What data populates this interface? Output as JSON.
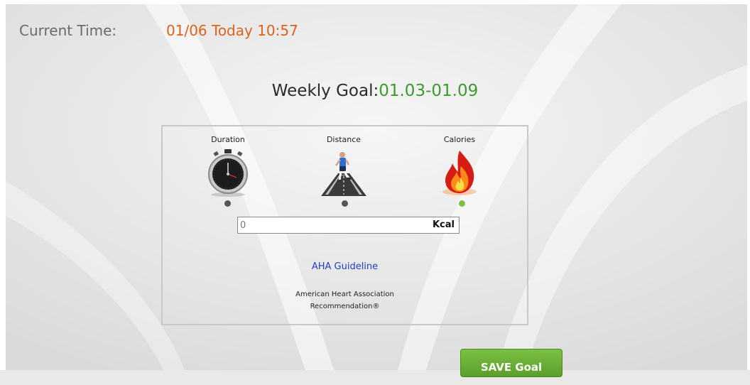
{
  "header": {
    "current_time_label": "Current Time:",
    "current_time_value": "01/06 Today 10:57"
  },
  "weekly_goal": {
    "label": "Weekly Goal:",
    "range": "01.03-01.09"
  },
  "metrics": [
    {
      "label": "Duration",
      "icon": "stopwatch-icon",
      "selected": false
    },
    {
      "label": "Distance",
      "icon": "runner-icon",
      "selected": false
    },
    {
      "label": "Calories",
      "icon": "flame-icon",
      "selected": true
    }
  ],
  "goal_input": {
    "placeholder": "0",
    "unit": "Kcal"
  },
  "guideline": {
    "link_text": "AHA Guideline",
    "description_line1": "American Heart Association",
    "description_line2": "Recommendation®"
  },
  "actions": {
    "save_label": "SAVE Goal"
  },
  "colors": {
    "time_value": "#e0601c",
    "range": "#3c9a2f",
    "link": "#1f3fc4",
    "active_dot": "#7cc243",
    "save_button": "#6bb236"
  }
}
